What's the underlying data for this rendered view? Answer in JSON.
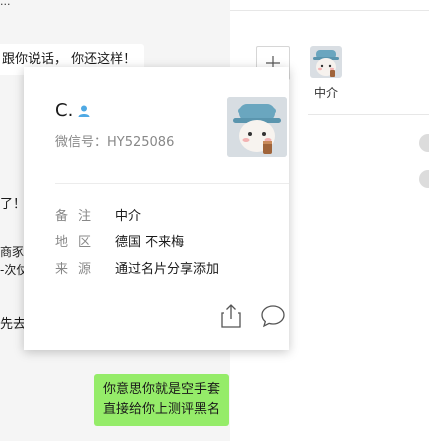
{
  "chat": {
    "top_partial": "...",
    "message_1": "跟你说话， 你还这样！",
    "frag_1": "了！",
    "frag_2a": "商豕",
    "frag_2b": "-次仗",
    "frag_3": "先去",
    "my_message_line1": "你意思你就是空手套",
    "my_message_line2": "直接给你上测评黑名"
  },
  "group_panel": {
    "add_member_icon": "plus-icon",
    "member_name": "中介"
  },
  "profile_card": {
    "name": "C.",
    "gender_icon": "person-icon",
    "wechat_id": "微信号：HY525086",
    "rows": [
      {
        "label": "备注",
        "value": "中介"
      },
      {
        "label": "地区",
        "value": "德国 不来梅"
      },
      {
        "label": "来源",
        "value": "通过名片分享添加"
      }
    ],
    "share_icon": "share-icon",
    "message_icon": "chat-bubble-icon"
  },
  "colors": {
    "accent_gender": "#4fa9e4",
    "my_bubble": "#95ec69",
    "background": "#f5f5f5"
  }
}
